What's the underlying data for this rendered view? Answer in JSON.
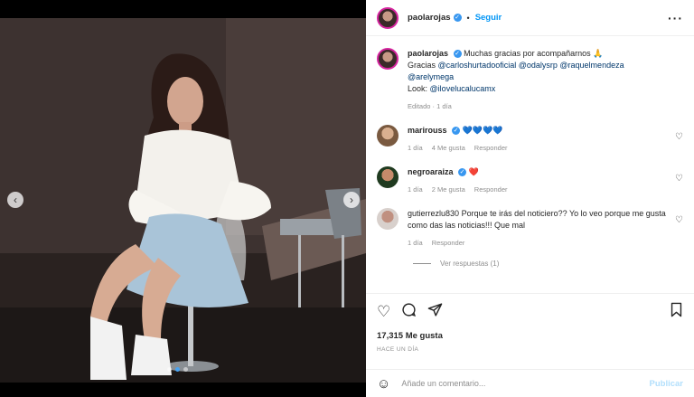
{
  "header": {
    "username": "paolarojas",
    "separator": "•",
    "follow_label": "Seguir",
    "more_icon": "more-horizontal-icon"
  },
  "caption": {
    "username": "paolarojas",
    "text": "Muchas gracias por acompañarnos 🙏",
    "gracias": "Gracias",
    "mentions": [
      "@carloshurtadooficial",
      "@odalysrp",
      "@raquelmendeza",
      "@arelymega"
    ],
    "look_label": "Look:",
    "look_mention": "@ilovelucalucamx",
    "meta": "Editado · 1 día"
  },
  "comments": [
    {
      "username": "marirouss",
      "verified": true,
      "text": "💙💙💙💙",
      "time": "1 día",
      "likes": "4 Me gusta",
      "reply": "Responder"
    },
    {
      "username": "negroaraiza",
      "verified": true,
      "text": "❤️",
      "time": "1 día",
      "likes": "2 Me gusta",
      "reply": "Responder"
    },
    {
      "username": "gutierrezlu830",
      "verified": false,
      "text": "Porque te irás del noticiero?? Yo lo veo porque me gusta como das las noticias!!! Que mal",
      "time": "1 día",
      "likes": "",
      "reply": "Responder"
    }
  ],
  "view_replies": "Ver respuestas (1)",
  "likes_count": "17,315 Me gusta",
  "timestamp": "HACE UN DÍA",
  "composer": {
    "placeholder": "Añade un comentario...",
    "post_label": "Publicar"
  },
  "icons": {
    "like": "heart-icon",
    "comment": "comment-icon",
    "share": "share-icon",
    "save": "bookmark-icon",
    "emoji": "emoji-icon"
  },
  "colors": {
    "accent": "#0095f6",
    "verified": "#3897f0",
    "muted": "#8e8e8e",
    "post_disabled": "#b2dffc"
  },
  "media": {
    "slide_count": 3,
    "active_slide": 2
  }
}
